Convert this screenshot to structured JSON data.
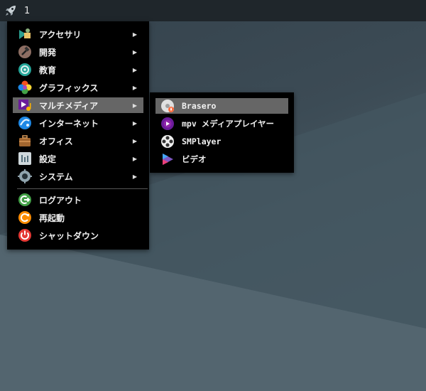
{
  "taskbar": {
    "launcher_icon": "rocket-icon",
    "workspace": "1"
  },
  "main_menu": {
    "categories": [
      {
        "label": "アクセサリ",
        "icon": "accessories-icon"
      },
      {
        "label": "開発",
        "icon": "development-icon"
      },
      {
        "label": "教育",
        "icon": "education-icon"
      },
      {
        "label": "グラフィックス",
        "icon": "graphics-icon"
      },
      {
        "label": "マルチメディア",
        "icon": "multimedia-icon",
        "selected": true
      },
      {
        "label": "インターネット",
        "icon": "internet-icon"
      },
      {
        "label": "オフィス",
        "icon": "office-icon"
      },
      {
        "label": "設定",
        "icon": "settings-icon"
      },
      {
        "label": "システム",
        "icon": "system-icon"
      }
    ],
    "session": [
      {
        "label": "ログアウト",
        "icon": "logout-icon"
      },
      {
        "label": "再起動",
        "icon": "reboot-icon"
      },
      {
        "label": "シャットダウン",
        "icon": "shutdown-icon"
      }
    ],
    "submenu_arrow": "▶"
  },
  "multimedia_submenu": {
    "items": [
      {
        "label": "Brasero",
        "icon": "brasero-icon",
        "selected": true
      },
      {
        "label": "mpv メディアプレイヤー",
        "icon": "mpv-icon"
      },
      {
        "label": "SMPlayer",
        "icon": "smplayer-icon"
      },
      {
        "label": "ビデオ",
        "icon": "video-icon"
      }
    ]
  },
  "colors": {
    "menu_bg": "#000000",
    "highlight": "#666666",
    "taskbar": "#1f262b"
  }
}
